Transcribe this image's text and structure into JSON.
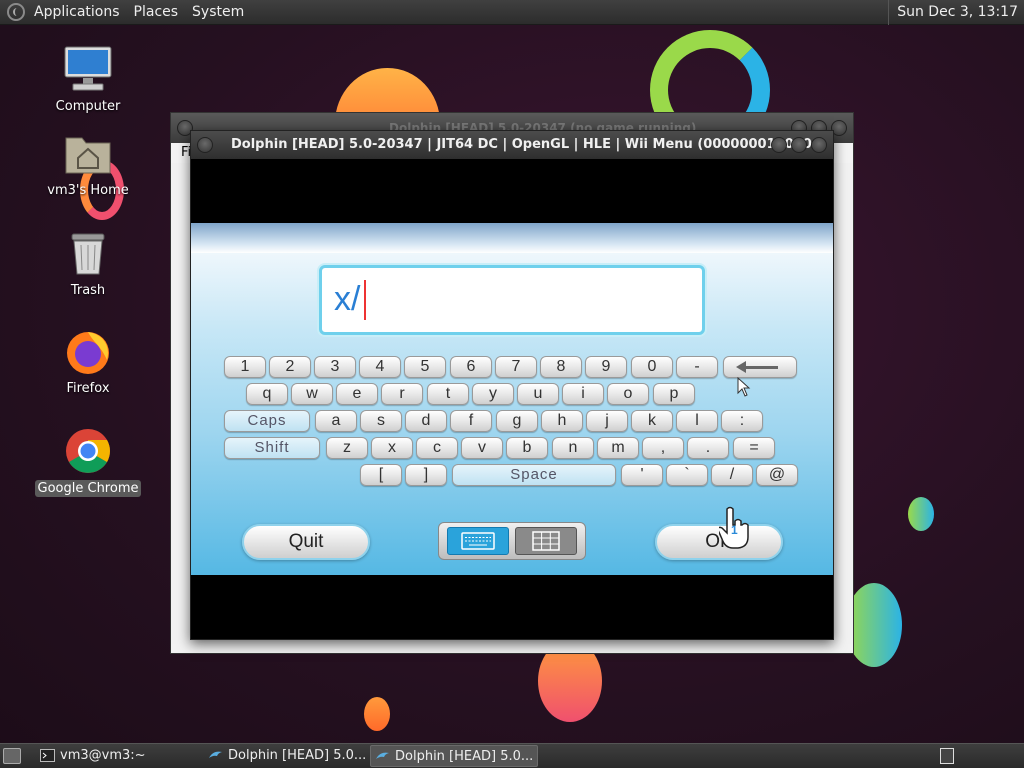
{
  "top_panel": {
    "menus": [
      "Applications",
      "Places",
      "System"
    ],
    "clock": "Sun Dec  3, 13:17"
  },
  "desktop_icons": [
    {
      "label": "Computer",
      "icon": "computer-icon"
    },
    {
      "label": "vm3's Home",
      "icon": "home-folder-icon"
    },
    {
      "label": "Trash",
      "icon": "trash-icon"
    },
    {
      "label": "Firefox",
      "icon": "firefox-icon"
    },
    {
      "label": "Google Chrome",
      "icon": "chrome-icon",
      "selected": true
    }
  ],
  "background_window": {
    "title": "Dolphin [HEAD] 5.0-20347 (no game running)",
    "menu_first": "Fi"
  },
  "dolphin_window": {
    "title": "Dolphin [HEAD] 5.0-20347 | JIT64 DC | OpenGL | HLE | Wii Menu (000000010000..."
  },
  "wii_keyboard": {
    "input_value": "x/",
    "rows": [
      [
        "1",
        "2",
        "3",
        "4",
        "5",
        "6",
        "7",
        "8",
        "9",
        "0",
        "-"
      ],
      [
        "q",
        "w",
        "e",
        "r",
        "t",
        "y",
        "u",
        "i",
        "o",
        "p"
      ],
      [
        "a",
        "s",
        "d",
        "f",
        "g",
        "h",
        "j",
        "k",
        "l",
        ":"
      ],
      [
        "z",
        "x",
        "c",
        "v",
        "b",
        "n",
        "m",
        ",",
        ".",
        "="
      ],
      [
        "[",
        "]",
        "'",
        "`",
        "/",
        "@"
      ]
    ],
    "caps_label": "Caps",
    "shift_label": "Shift",
    "space_label": "Space",
    "quit_label": "Quit",
    "ok_label": "OK",
    "cursor_badge": "1"
  },
  "taskbar": {
    "tasks": [
      {
        "label": "vm3@vm3:~",
        "icon": "terminal-icon",
        "active": false
      },
      {
        "label": "Dolphin [HEAD] 5.0...",
        "icon": "dolphin-icon",
        "active": false
      },
      {
        "label": "Dolphin [HEAD] 5.0...",
        "icon": "dolphin-icon",
        "active": true
      }
    ]
  },
  "colors": {
    "wii_blue": "#2aa3db",
    "textbox_border": "#6fd0ec",
    "input_text": "#2a7fd4"
  }
}
